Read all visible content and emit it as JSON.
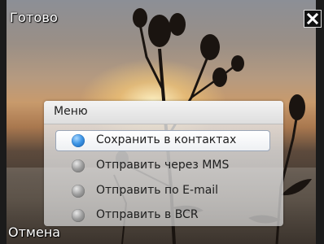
{
  "softkeys": {
    "left_top": "Готово",
    "left_bottom": "Отмена"
  },
  "menu": {
    "title": "Меню",
    "items": [
      {
        "label": "Сохранить в контактах",
        "selected": true
      },
      {
        "label": "Отправить через MMS",
        "selected": false
      },
      {
        "label": "Отправить по E-mail",
        "selected": false
      },
      {
        "label": "Отправить в BCR",
        "selected": false
      }
    ]
  },
  "icons": {
    "close": "close-icon",
    "radio_on": "radio-selected-icon",
    "radio_off": "radio-unselected-icon"
  },
  "colors": {
    "radio_selected": "#3f96e6",
    "radio_unselected": "#9c9c9c"
  }
}
